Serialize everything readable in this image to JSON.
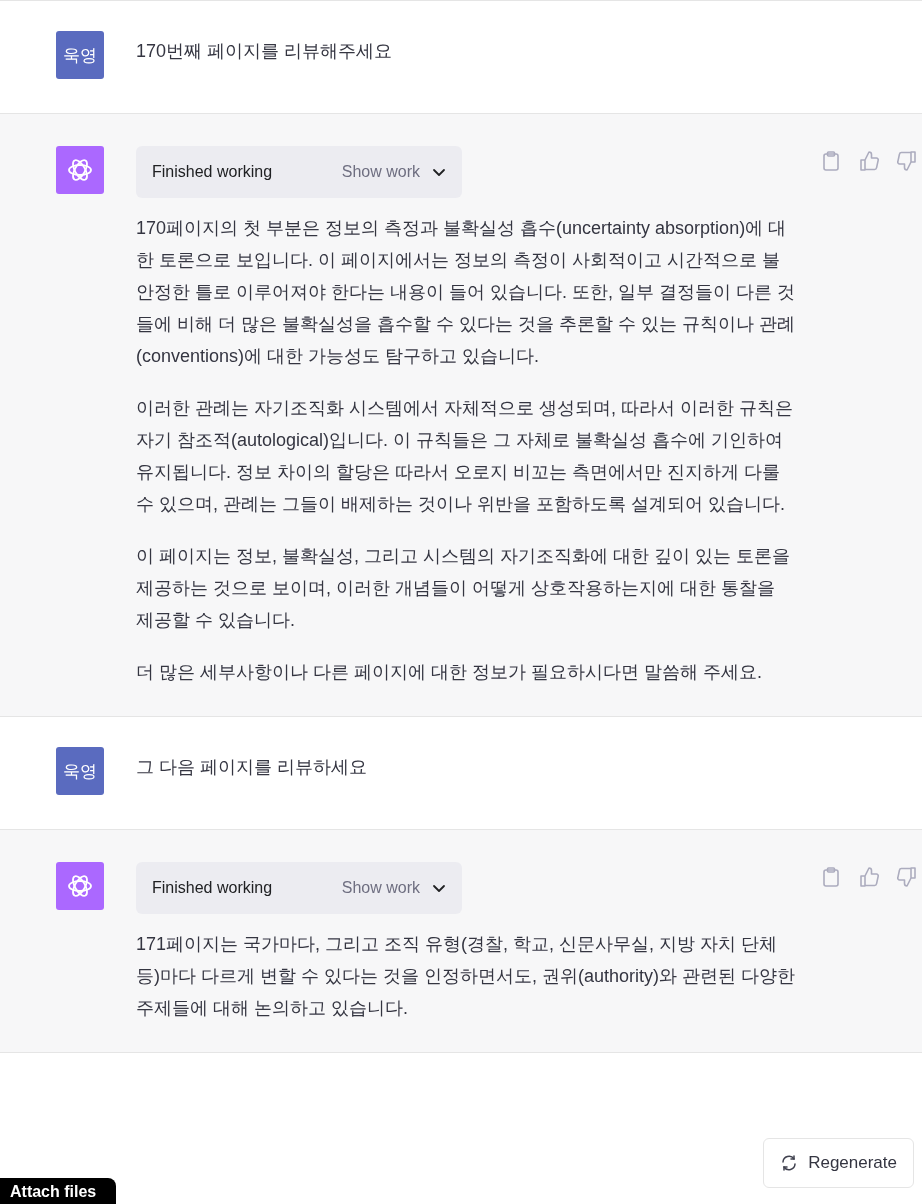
{
  "messages": [
    {
      "kind": "user",
      "avatar": "욱영",
      "text": "170번째 페이지를 리뷰해주세요"
    },
    {
      "kind": "assistant",
      "status": "Finished working",
      "toggle": "Show work",
      "paragraphs": [
        "170페이지의 첫 부분은 정보의 측정과 불확실성 흡수(uncertainty absorption)에 대한 토론으로 보입니다. 이 페이지에서는 정보의 측정이 사회적이고 시간적으로 불안정한 틀로 이루어져야 한다는 내용이 들어 있습니다. 또한, 일부 결정들이 다른 것들에 비해 더 많은 불확실성을 흡수할 수 있다는 것을 추론할 수 있는 규칙이나 관례(conventions)에 대한 가능성도 탐구하고 있습니다.",
        "이러한 관례는 자기조직화 시스템에서 자체적으로 생성되며, 따라서 이러한 규칙은 자기 참조적(autological)입니다. 이 규칙들은 그 자체로 불확실성 흡수에 기인하여 유지됩니다. 정보 차이의 할당은 따라서 오로지 비꼬는 측면에서만 진지하게 다룰 수 있으며, 관례는 그들이 배제하는 것이나 위반을 포함하도록 설계되어 있습니다.",
        "이 페이지는 정보, 불확실성, 그리고 시스템의 자기조직화에 대한 깊이 있는 토론을 제공하는 것으로 보이며, 이러한 개념들이 어떻게 상호작용하는지에 대한 통찰을 제공할 수 있습니다.",
        "더 많은 세부사항이나 다른 페이지에 대한 정보가 필요하시다면 말씀해 주세요."
      ]
    },
    {
      "kind": "user",
      "avatar": "욱영",
      "text": "그 다음 페이지를 리뷰하세요"
    },
    {
      "kind": "assistant",
      "status": "Finished working",
      "toggle": "Show work",
      "paragraphs": [
        "171페이지는 국가마다, 그리고 조직 유형(경찰, 학교, 신문사무실, 지방 자치 단체 등)마다 다르게 변할 수 있다는 것을 인정하면서도, 권위(authority)와 관련된 다양한 주제들에 대해 논의하고 있습니다."
      ]
    }
  ],
  "regenerate_button": "Regenerate",
  "attach_button": "Attach files"
}
